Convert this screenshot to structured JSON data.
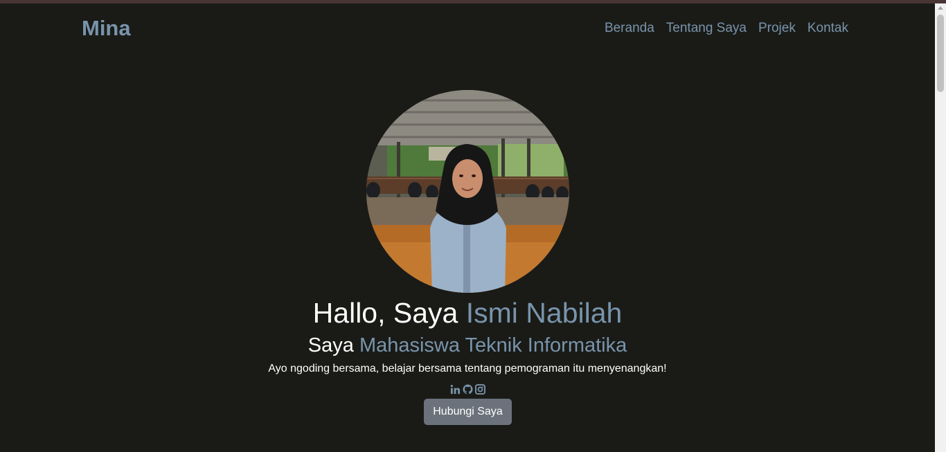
{
  "navbar": {
    "brand": "Mina",
    "links": [
      "Beranda",
      "Tentang Saya",
      "Projek",
      "Kontak"
    ]
  },
  "hero": {
    "greeting_prefix": "Hallo, Saya ",
    "name": "Ismi Nabilah",
    "role_prefix": "Saya ",
    "role": "Mahasiswa Teknik Informatika",
    "tagline": "Ayo ngoding bersama, belajar bersama tentang pemograman itu menyenangkan!",
    "cta_label": "Hubungi Saya",
    "socials": [
      "linkedin-icon",
      "github-icon",
      "instagram-icon"
    ]
  },
  "colors": {
    "background": "#1a1b17",
    "accent": "#7994ac",
    "text": "#ffffff",
    "button": "#6c727c"
  }
}
